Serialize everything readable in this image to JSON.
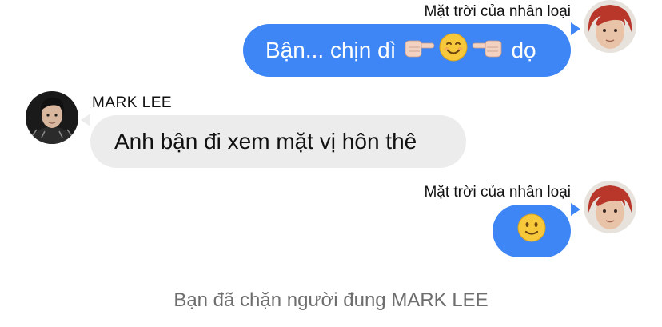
{
  "messages": [
    {
      "sender": "Mặt trời của nhân loại",
      "text_before": "Bận... chịn dì",
      "text_after": "dọ",
      "emojis": [
        "pointing-right-icon",
        "smiling-face-icon",
        "pointing-left-icon"
      ]
    },
    {
      "sender": "MARK LEE",
      "text": "Anh bận đi xem mặt vị hôn thê"
    },
    {
      "sender": "Mặt trời của nhân loại",
      "emojis": [
        "slightly-smiling-face-icon"
      ]
    }
  ],
  "system_note": "Bạn đã chặn người đung MARK LEE",
  "colors": {
    "outgoing_bubble": "#3e86f5",
    "incoming_bubble": "#ececec",
    "system_text": "#6e6e6e",
    "emoji_yellow": "#f6c83a",
    "avatar_hair": "#b8362a"
  }
}
